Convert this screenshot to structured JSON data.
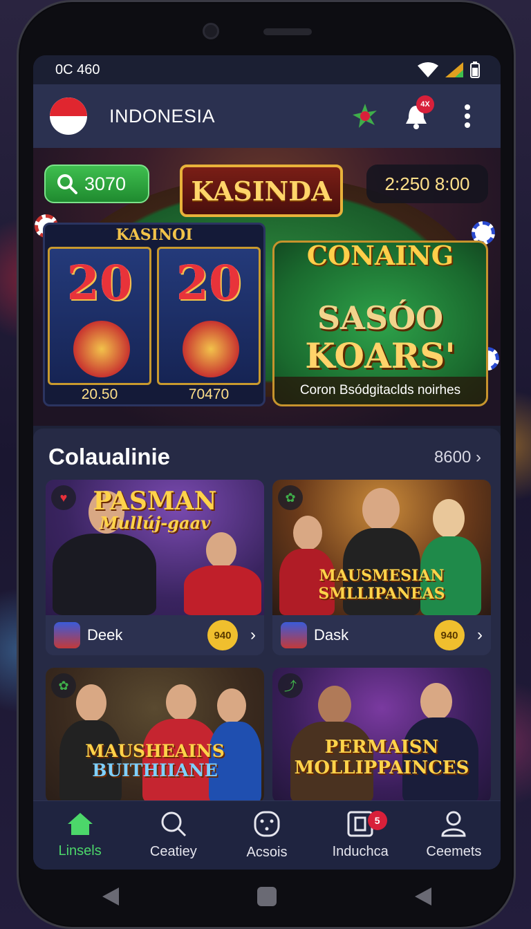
{
  "status": {
    "time": "0C 460"
  },
  "header": {
    "title": "INDONESIA",
    "notif_badge": "4X"
  },
  "banner": {
    "search_value": "3070",
    "logo": "KASINDA",
    "timer": "2:250 8:00",
    "slot_title": "KASINOI",
    "reels": [
      {
        "number": "20",
        "value": "20.50"
      },
      {
        "number": "20",
        "value": "70470"
      }
    ],
    "right_title": "CONAING",
    "right_big1": "SASÓO",
    "right_big2": "KOARS'",
    "right_caption": "Coron Bsódgitaclds noirhes"
  },
  "section": {
    "title": "Colaualinie",
    "more": "8600",
    "cards": [
      {
        "title1": "PASMAN",
        "title2": "Mullúj-gaav",
        "name": "Deek",
        "coin": "940"
      },
      {
        "title1": "MAUSMESIAN",
        "title2": "SMLLIPANEAS",
        "name": "Dask",
        "coin": "940"
      },
      {
        "title1": "MAUSHEAINS",
        "title2": "BUITHIIANE"
      },
      {
        "title1": "PERMAISN",
        "title2": "MOLLIPPAINCES"
      }
    ]
  },
  "nav": {
    "items": [
      {
        "label": "Linsels"
      },
      {
        "label": "Ceatiey"
      },
      {
        "label": "Acsois"
      },
      {
        "label": "Induchca",
        "badge": "5"
      },
      {
        "label": "Ceemets"
      }
    ]
  },
  "colors": {
    "accent": "#4cd76a",
    "gold": "#f0bf2e",
    "badge": "#d8203a",
    "panel": "#262a45"
  }
}
